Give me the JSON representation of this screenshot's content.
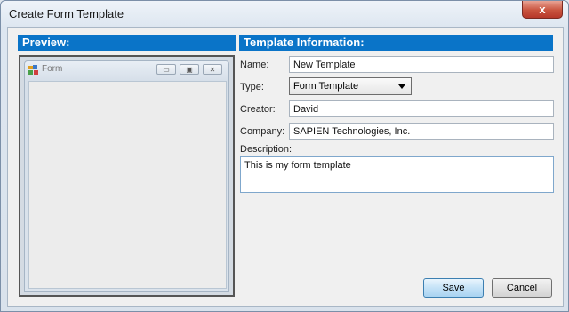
{
  "window": {
    "title": "Create Form Template",
    "close_glyph": "x"
  },
  "preview": {
    "header": "Preview:",
    "mini_form": {
      "title": "Form",
      "icon": "form-icon"
    }
  },
  "info": {
    "header": "Template Information:",
    "fields": {
      "name_label": "Name:",
      "name_value": "New Template",
      "type_label": "Type:",
      "type_value": "Form Template",
      "creator_label": "Creator:",
      "creator_value": "David",
      "company_label": "Company:",
      "company_value": "SAPIEN Technologies, Inc.",
      "description_label": "Description:",
      "description_value": "This is my form template"
    }
  },
  "buttons": {
    "save_first": "S",
    "save_rest": "ave",
    "cancel_first": "C",
    "cancel_rest": "ancel"
  },
  "colors": {
    "header_blue": "#0a74c8",
    "close_red": "#c9543f"
  }
}
